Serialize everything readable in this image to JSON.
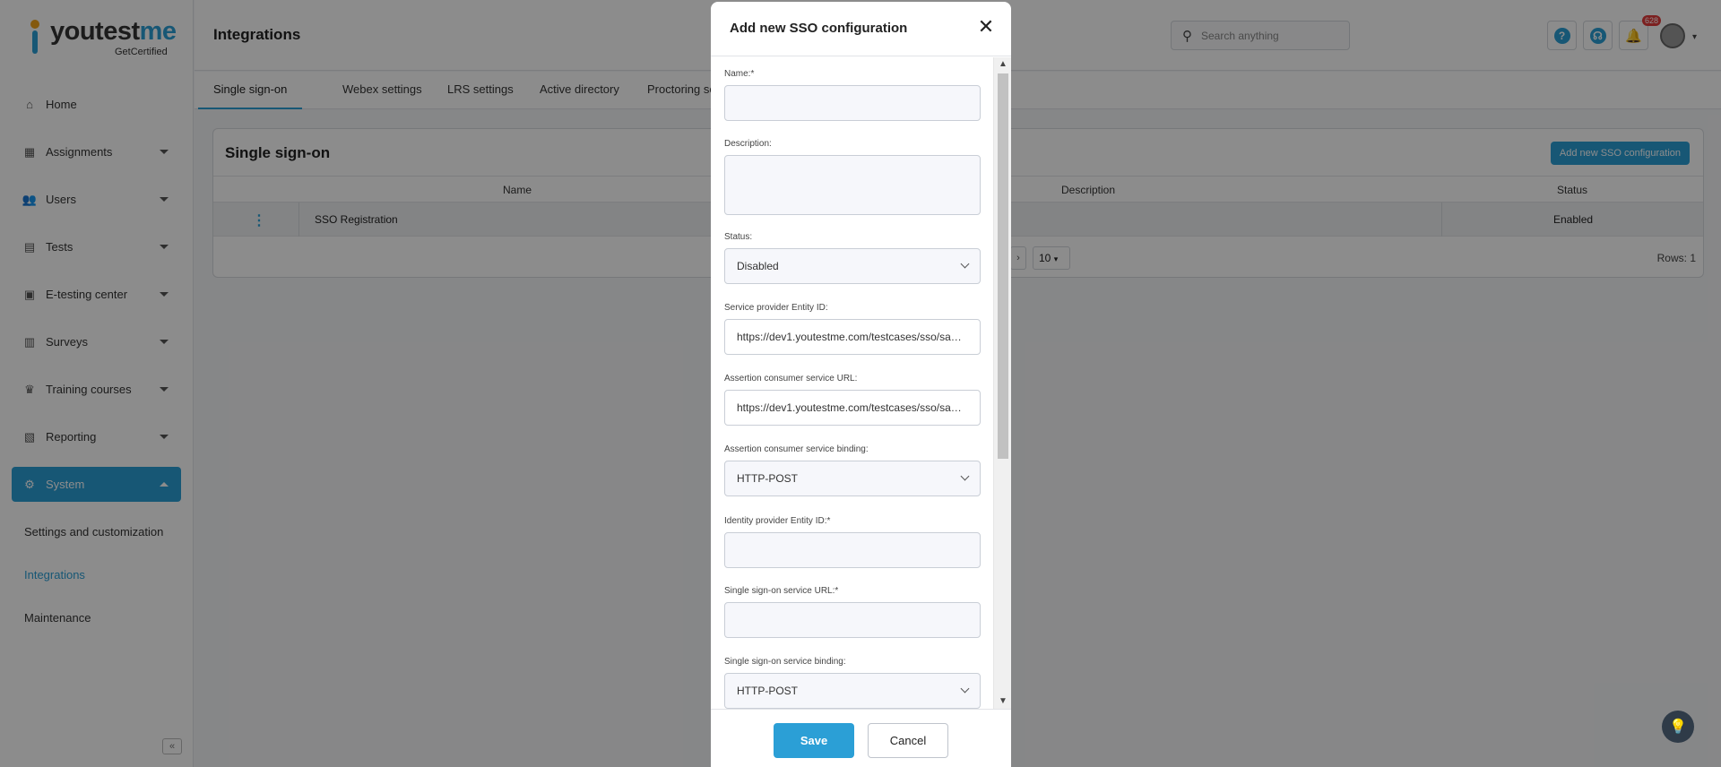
{
  "brand": {
    "name_a": "youtest",
    "name_b": "me",
    "sub": "GetCertified"
  },
  "sidebar": {
    "items": [
      {
        "label": "Home",
        "icon": "home-icon",
        "glyph": "⌂"
      },
      {
        "label": "Assignments",
        "icon": "dashboard-icon",
        "glyph": "▦"
      },
      {
        "label": "Users",
        "icon": "users-icon",
        "glyph": "👥"
      },
      {
        "label": "Tests",
        "icon": "tests-icon",
        "glyph": "▤"
      },
      {
        "label": "E-testing center",
        "icon": "calendar-icon",
        "glyph": "▣"
      },
      {
        "label": "Surveys",
        "icon": "surveys-icon",
        "glyph": "▥"
      },
      {
        "label": "Training courses",
        "icon": "trophy-icon",
        "glyph": "♛"
      },
      {
        "label": "Reporting",
        "icon": "reporting-icon",
        "glyph": "▧"
      },
      {
        "label": "System",
        "icon": "gear-icon",
        "glyph": "⚙"
      }
    ],
    "sub_items": [
      "Settings and customization",
      "Integrations",
      "Maintenance"
    ]
  },
  "header": {
    "title": "Integrations",
    "search_placeholder": "Search anything",
    "notification_count": "628",
    "help_glyph": "?",
    "support_glyph": "☊",
    "bell_glyph": "🔔"
  },
  "tabs": [
    "Single sign-on",
    "Webex settings",
    "LRS settings",
    "Active directory",
    "Proctoring setti"
  ],
  "card": {
    "title": "Single sign-on",
    "add_button": "Add new SSO configuration",
    "columns": [
      "Name",
      "Description",
      "Status"
    ],
    "rows": [
      {
        "name": "SSO Registration",
        "description": "",
        "status": "Enabled"
      }
    ],
    "page_size": "10",
    "rows_count": "Rows: 1"
  },
  "modal": {
    "title": "Add new SSO configuration",
    "fields": {
      "name_label": "Name:*",
      "name_value": "",
      "description_label": "Description:",
      "description_value": "",
      "status_label": "Status:",
      "status_value": "Disabled",
      "sp_entity_label": "Service provider Entity ID:",
      "sp_entity_value": "https://dev1.youtestme.com/testcases/sso/sa…",
      "acs_url_label": "Assertion consumer service URL:",
      "acs_url_value": "https://dev1.youtestme.com/testcases/sso/sa…",
      "acs_binding_label": "Assertion consumer service binding:",
      "acs_binding_value": "HTTP-POST",
      "idp_entity_label": "Identity provider Entity ID:*",
      "idp_entity_value": "",
      "sso_url_label": "Single sign-on service URL:*",
      "sso_url_value": "",
      "sso_binding_label": "Single sign-on service binding:",
      "sso_binding_value": "HTTP-POST"
    },
    "save_label": "Save",
    "cancel_label": "Cancel"
  },
  "colors": {
    "accent": "#2b9fd6",
    "badge": "#e23b3b",
    "overlay": "rgba(0,0,0,0.45)"
  }
}
